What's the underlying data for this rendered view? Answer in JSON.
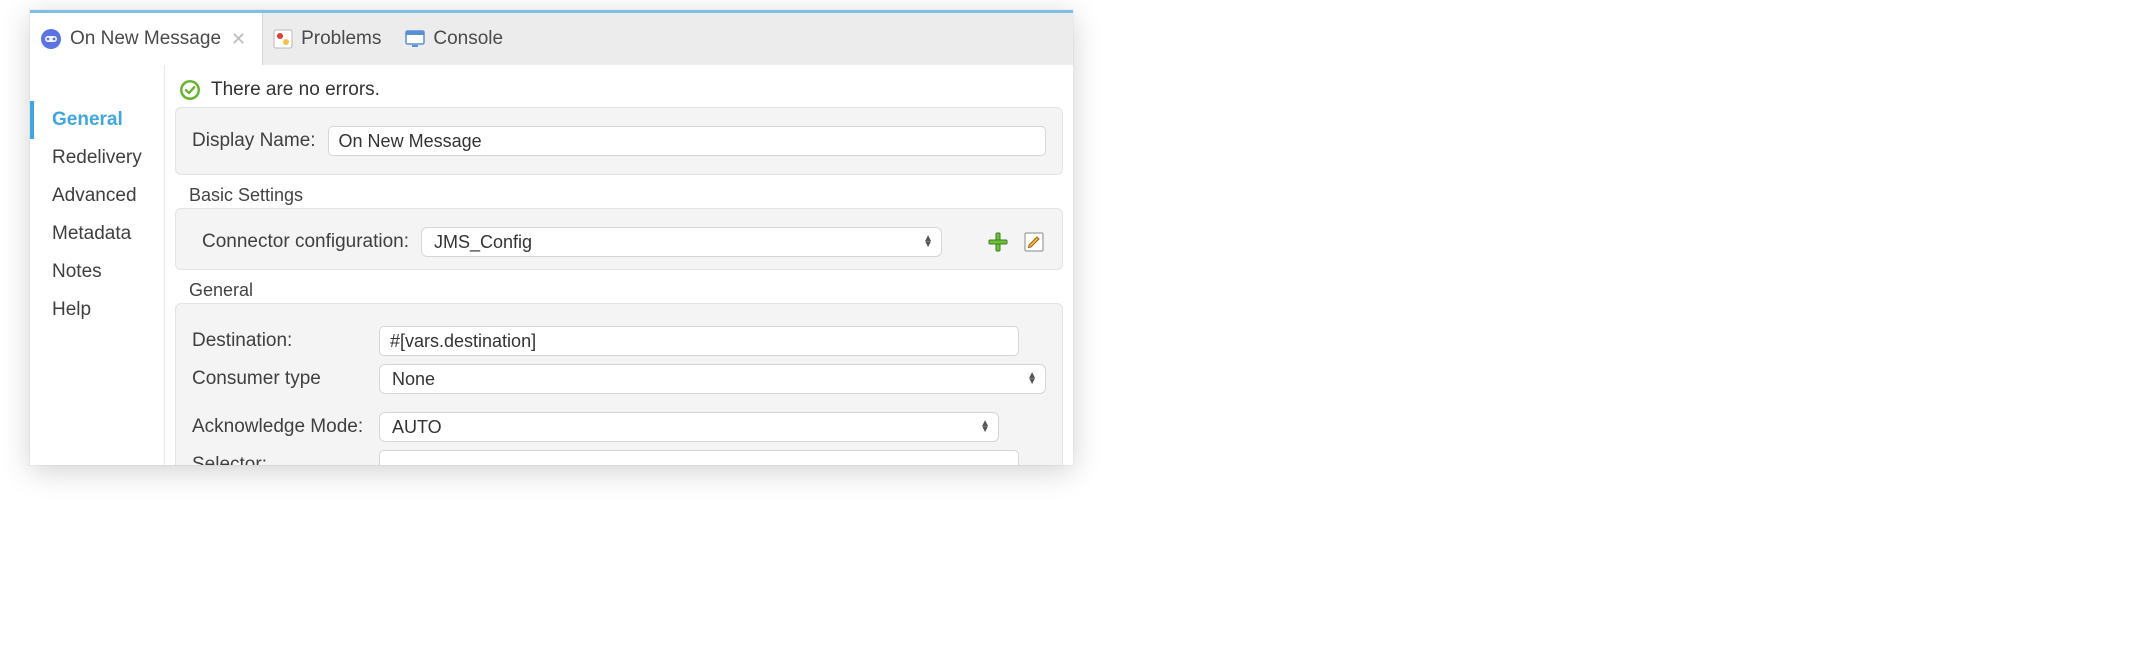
{
  "tabs": {
    "active": {
      "label": "On New Message"
    },
    "problems": {
      "label": "Problems"
    },
    "console": {
      "label": "Console"
    }
  },
  "sidebar": {
    "items": [
      {
        "label": "General",
        "active": true
      },
      {
        "label": "Redelivery"
      },
      {
        "label": "Advanced"
      },
      {
        "label": "Metadata"
      },
      {
        "label": "Notes"
      },
      {
        "label": "Help"
      }
    ]
  },
  "status": {
    "message": "There are no errors."
  },
  "display_name": {
    "label": "Display Name:",
    "value": "On New Message"
  },
  "basic_settings": {
    "title": "Basic Settings",
    "connector_label": "Connector configuration:",
    "connector_value": "JMS_Config"
  },
  "general": {
    "title": "General",
    "destination_label": "Destination:",
    "destination_value": "#[vars.destination]",
    "consumer_type_label": "Consumer type",
    "consumer_type_value": "None",
    "ack_mode_label": "Acknowledge Mode:",
    "ack_mode_value": "AUTO",
    "selector_label": "Selector:",
    "selector_value": ""
  }
}
